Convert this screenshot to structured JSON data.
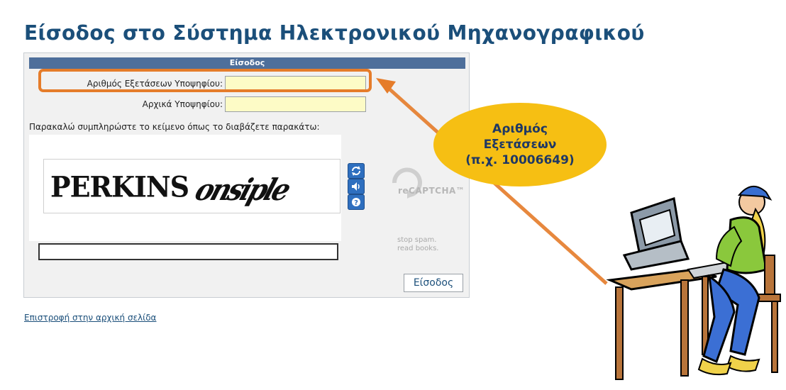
{
  "page": {
    "title": "Είσοδος στο Σύστημα Ηλεκτρονικού Μηχανογραφικού"
  },
  "login_form": {
    "header": "Είσοδος",
    "exam_number_label": "Αριθμός Εξετάσεων Υποψηφίου:",
    "exam_number_value": "",
    "initials_label": "Αρχικά Υποψηφίου:",
    "initials_value": "",
    "instructions": "Παρακαλώ συμπληρώστε το κείμενο όπως το διαβάζετε παρακάτω:",
    "submit_label": "Είσοδος"
  },
  "recaptcha": {
    "word1": "PERKINS",
    "word2": "onsiple",
    "reload_icon": "refresh-icon",
    "audio_icon": "speaker-icon",
    "help_icon": "help-icon",
    "logo_text": "reCAPTCHA™",
    "tagline_line1": "stop spam.",
    "tagline_line2": "read books.",
    "response_value": ""
  },
  "footer": {
    "back_link": "Επιστροφή στην αρχική σελίδα"
  },
  "annotation": {
    "line1": "Αριθμός",
    "line2": "Εξετάσεων",
    "line3": "(π.χ. 10006649)"
  },
  "colors": {
    "title": "#1b4f7a",
    "header_bar": "#4e6f9b",
    "input_bg": "#fdfbc6",
    "highlight": "#e57c2a",
    "bubble": "#f6bf13",
    "bubble_text": "#1f3864"
  }
}
